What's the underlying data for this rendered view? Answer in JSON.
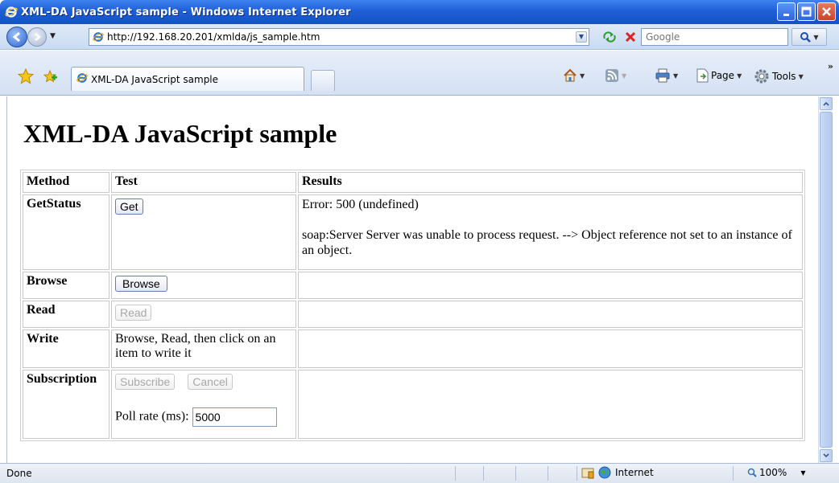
{
  "window": {
    "title": "XML-DA JavaScript sample - Windows Internet Explorer"
  },
  "addressbar": {
    "url": "http://192.168.20.201/xmlda/js_sample.htm",
    "search_placeholder": "Google"
  },
  "tabbar": {
    "tab_label": "XML-DA JavaScript sample",
    "page_label": "Page",
    "tools_label": "Tools"
  },
  "page": {
    "heading": "XML-DA JavaScript sample",
    "table": {
      "headers": {
        "method": "Method",
        "test": "Test",
        "results": "Results"
      },
      "rows": {
        "getstatus": {
          "method": "GetStatus",
          "button": "Get",
          "result_line1": "Error: 500 (undefined)",
          "result_line2": "soap:Server Server was unable to process request. --> Object reference not set to an instance of an object."
        },
        "browse": {
          "method": "Browse",
          "button": "Browse"
        },
        "read": {
          "method": "Read",
          "button": "Read"
        },
        "write": {
          "method": "Write",
          "test_text": "Browse, Read, then click on an item to write it"
        },
        "subscription": {
          "method": "Subscription",
          "subscribe_button": "Subscribe",
          "cancel_button": "Cancel",
          "poll_label": "Poll rate (ms):",
          "poll_value": "5000"
        }
      }
    }
  },
  "statusbar": {
    "status": "Done",
    "zone": "Internet",
    "zoom": "100%"
  },
  "icons": {
    "ie": "ie-logo-icon",
    "back": "back-arrow-icon",
    "forward": "forward-arrow-icon",
    "refresh": "refresh-icon",
    "stop": "stop-icon",
    "search": "magnifier-icon",
    "favorites": "favorites-star-icon",
    "add_favorites": "add-favorites-icon",
    "home": "home-icon",
    "feeds": "rss-feed-icon",
    "print": "printer-icon",
    "page": "page-icon",
    "tools": "gear-icon",
    "zone": "globe-icon",
    "zoom": "zoom-magnifier-icon"
  },
  "colors": {
    "titlebar": "#1f5fd6",
    "chrome": "#d4e1f3",
    "close_button": "#c8452a"
  }
}
